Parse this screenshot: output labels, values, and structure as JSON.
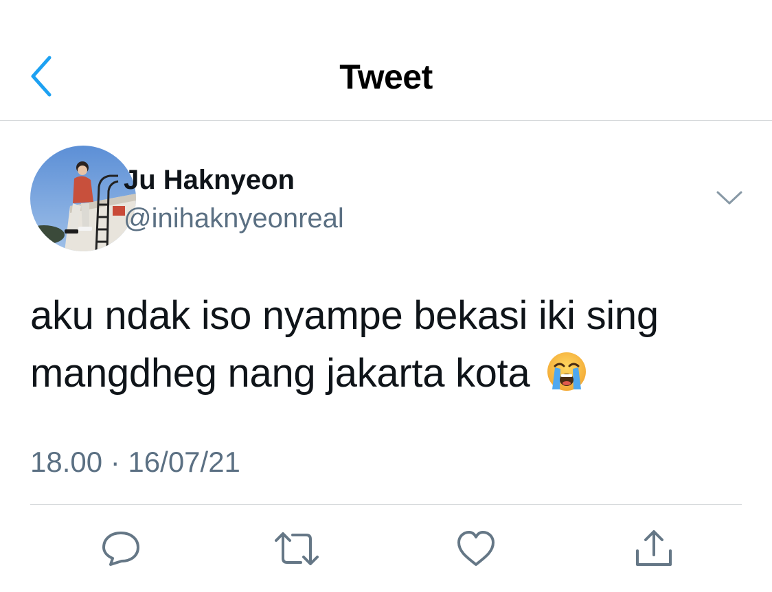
{
  "header": {
    "title": "Tweet",
    "back_icon": "chevron-left-icon"
  },
  "author": {
    "name": "Ju Haknyeon",
    "handle": "@inihaknyeonreal",
    "avatar_icon": "profile-photo"
  },
  "tweet": {
    "text_line1": "aku ndak iso nyampe bekasi iki sing",
    "text_line2": "mangdheg nang jakarta kota",
    "emoji": "loudly-crying-face",
    "timestamp": "18.00 · 16/07/21"
  },
  "actions": [
    {
      "icon": "reply-icon"
    },
    {
      "icon": "retweet-icon"
    },
    {
      "icon": "like-icon"
    },
    {
      "icon": "share-icon"
    }
  ],
  "colors": {
    "accent": "#1da1f2",
    "text": "#0f1419",
    "secondary_text": "#5b7083",
    "divider": "#d6d9db",
    "icon_gray": "#657786"
  }
}
